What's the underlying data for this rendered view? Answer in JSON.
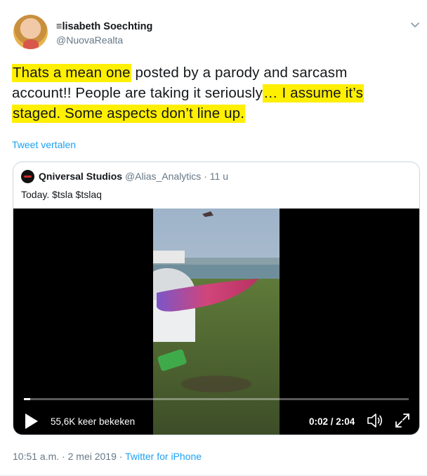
{
  "author": {
    "name": "≡lisabeth Soechting",
    "handle": "@NuovaRealta"
  },
  "tweet": {
    "lines": [
      [
        {
          "text": "Thats a mean one",
          "highlight": true
        },
        {
          "text": " posted by a parody and sarcasm",
          "highlight": false
        }
      ],
      [
        {
          "text": "account!! People are taking it seriously",
          "highlight": false
        },
        {
          "text": "… I assume it’s",
          "highlight": true
        }
      ],
      [
        {
          "text": "staged. Some aspects don’t line up.",
          "highlight": true
        }
      ]
    ],
    "translate_label": "Tweet vertalen",
    "highlight_color": "#ffef00"
  },
  "quoted": {
    "name": "Qniversal Studios",
    "handle": "@Alias_Analytics",
    "separator": "·",
    "time": "11 u",
    "text": "Today. $tsla $tslaq",
    "video": {
      "views": "55,6K keer bekeken",
      "time_display": "0:02 / 2:04",
      "progress": 0.016
    }
  },
  "meta": {
    "time": "10:51 a.m.",
    "separator1": "·",
    "date": "2 mei 2019",
    "separator2": "·",
    "client": "Twitter for iPhone"
  },
  "colors": {
    "link": "#1da1f2",
    "secondary_text": "#657786",
    "border": "#ccd6dd"
  },
  "icons": [
    "chevron-down-icon",
    "play-icon",
    "volume-icon",
    "fullscreen-icon"
  ]
}
